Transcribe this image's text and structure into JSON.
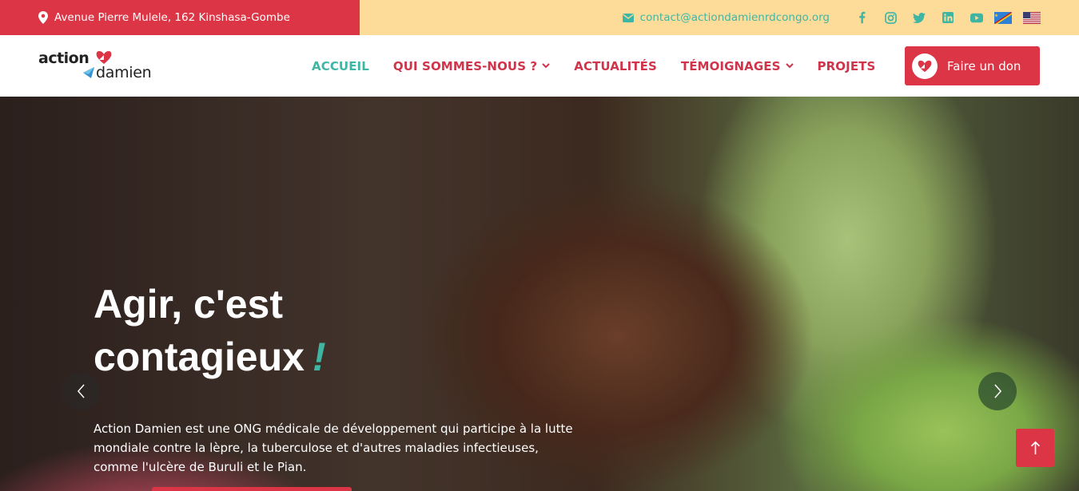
{
  "topbar": {
    "address": "Avenue Pierre Mulele, 162 Kinshasa-Gombe",
    "email": "contact@actiondamienrdcongo.org",
    "social_icons": [
      "facebook-icon",
      "instagram-icon",
      "twitter-icon",
      "linkedin-icon",
      "youtube-icon"
    ],
    "languages": [
      "drc-flag",
      "us-flag"
    ]
  },
  "logo": {
    "word1": "action",
    "word2": "damien"
  },
  "nav": {
    "items": [
      {
        "label": "ACCUEIL",
        "active": true,
        "dropdown": false
      },
      {
        "label": "QUI SOMMES-NOUS ?",
        "active": false,
        "dropdown": true
      },
      {
        "label": "ACTUALITÉS",
        "active": false,
        "dropdown": false
      },
      {
        "label": "TÉMOIGNAGES",
        "active": false,
        "dropdown": true
      },
      {
        "label": "PROJETS",
        "active": false,
        "dropdown": false
      }
    ],
    "donate_label": "Faire un don"
  },
  "hero": {
    "title_line1": "Agir, c'est",
    "title_line2": "contagieux",
    "title_mark": "!",
    "text": "Action Damien est une ONG médicale de développement qui participe à la lutte mondiale contre la lèpre, la tuberculose et d'autres maladies infectieuses, comme l'ulcère de Buruli et le Pian."
  },
  "colors": {
    "primary_red": "#dc3545",
    "accent_teal": "#3fb6a4",
    "topbar_yellow": "#fddc9a",
    "nav_red": "#d0344a"
  }
}
